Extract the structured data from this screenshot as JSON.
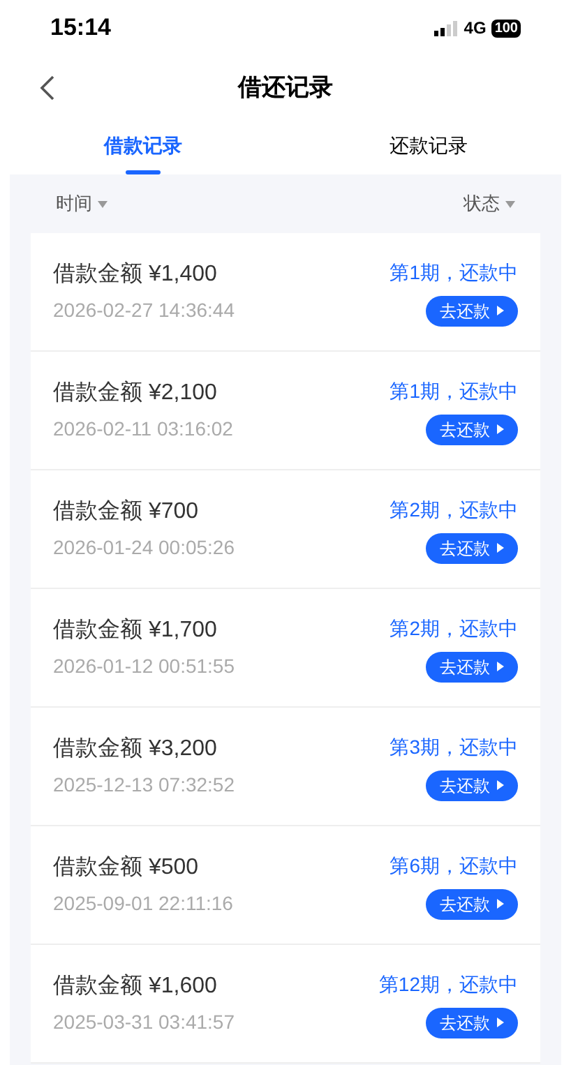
{
  "status_bar": {
    "time": "15:14",
    "network": "4G",
    "battery": "100"
  },
  "nav": {
    "title": "借还记录"
  },
  "tabs": [
    {
      "label": "借款记录",
      "selected": true
    },
    {
      "label": "还款记录",
      "selected": false
    }
  ],
  "filters": [
    {
      "label": "时间"
    },
    {
      "label": "状态"
    }
  ],
  "records": [
    {
      "amount": "借款金额 ¥1,400",
      "time": "2026-02-27 14:36:44",
      "status": "第1期，还款中",
      "action": "去还款"
    },
    {
      "amount": "借款金额 ¥2,100",
      "time": "2026-02-11 03:16:02",
      "status": "第1期，还款中",
      "action": "去还款"
    },
    {
      "amount": "借款金额 ¥700",
      "time": "2026-01-24 00:05:26",
      "status": "第2期，还款中",
      "action": "去还款"
    },
    {
      "amount": "借款金额 ¥1,700",
      "time": "2026-01-12 00:51:55",
      "status": "第2期，还款中",
      "action": "去还款"
    },
    {
      "amount": "借款金额 ¥3,200",
      "time": "2025-12-13 07:32:52",
      "status": "第3期，还款中",
      "action": "去还款"
    },
    {
      "amount": "借款金额 ¥500",
      "time": "2025-09-01 22:11:16",
      "status": "第6期，还款中",
      "action": "去还款"
    },
    {
      "amount": "借款金额 ¥1,600",
      "time": "2025-03-31 03:41:57",
      "status": "第12期，还款中",
      "action": "去还款"
    }
  ]
}
